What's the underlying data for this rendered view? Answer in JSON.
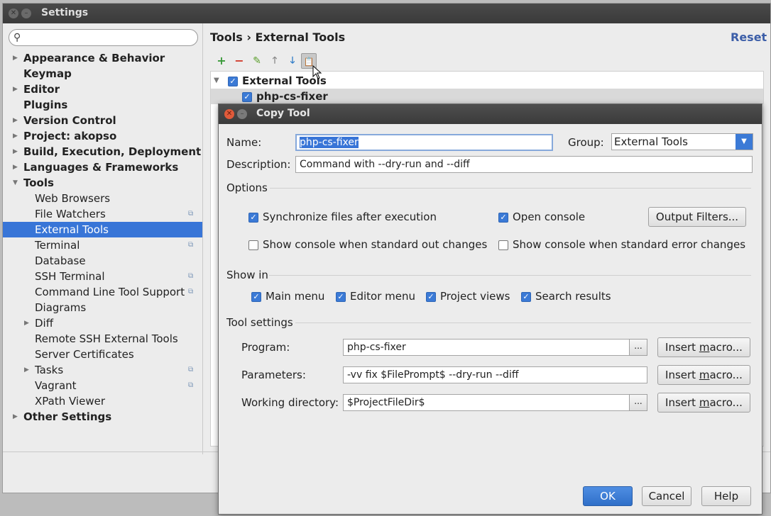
{
  "window": {
    "title": "Settings"
  },
  "search": {
    "placeholder": ""
  },
  "sidebar": {
    "items": [
      {
        "label": "Appearance & Behavior",
        "level": 0,
        "arrow": "▶"
      },
      {
        "label": "Keymap",
        "level": 0,
        "arrow": ""
      },
      {
        "label": "Editor",
        "level": 0,
        "arrow": "▶"
      },
      {
        "label": "Plugins",
        "level": 0,
        "arrow": ""
      },
      {
        "label": "Version Control",
        "level": 0,
        "arrow": "▶"
      },
      {
        "label": "Project: akopso",
        "level": 0,
        "arrow": "▶"
      },
      {
        "label": "Build, Execution, Deployment",
        "level": 0,
        "arrow": "▶"
      },
      {
        "label": "Languages & Frameworks",
        "level": 0,
        "arrow": "▶"
      },
      {
        "label": "Tools",
        "level": 0,
        "arrow": "▼"
      },
      {
        "label": "Web Browsers",
        "level": 1,
        "arrow": ""
      },
      {
        "label": "File Watchers",
        "level": 1,
        "arrow": "",
        "project": true
      },
      {
        "label": "External Tools",
        "level": 1,
        "arrow": "",
        "selected": true
      },
      {
        "label": "Terminal",
        "level": 1,
        "arrow": "",
        "project": true
      },
      {
        "label": "Database",
        "level": 1,
        "arrow": ""
      },
      {
        "label": "SSH Terminal",
        "level": 1,
        "arrow": "",
        "project": true
      },
      {
        "label": "Command Line Tool Support",
        "level": 1,
        "arrow": "",
        "project": true
      },
      {
        "label": "Diagrams",
        "level": 1,
        "arrow": ""
      },
      {
        "label": "Diff",
        "level": 1,
        "arrow": "▶"
      },
      {
        "label": "Remote SSH External Tools",
        "level": 1,
        "arrow": ""
      },
      {
        "label": "Server Certificates",
        "level": 1,
        "arrow": ""
      },
      {
        "label": "Tasks",
        "level": 1,
        "arrow": "▶",
        "project": true
      },
      {
        "label": "Vagrant",
        "level": 1,
        "arrow": "",
        "project": true
      },
      {
        "label": "XPath Viewer",
        "level": 1,
        "arrow": ""
      },
      {
        "label": "Other Settings",
        "level": 0,
        "arrow": "▶"
      }
    ]
  },
  "header": {
    "breadcrumb": "Tools › External Tools",
    "reset": "Reset"
  },
  "toolbar": {
    "add": "+",
    "remove": "−",
    "edit": "✎",
    "up": "🡑",
    "down": "🡓",
    "copy": "📋"
  },
  "list": {
    "group": "External Tools",
    "tool": "php-cs-fixer"
  },
  "dialog": {
    "title": "Copy Tool",
    "name_label": "Name:",
    "name_value": "php-cs-fixer",
    "group_label": "Group:",
    "group_value": "External Tools",
    "description_label": "Description:",
    "description_value": "Command with --dry-run and --diff",
    "options_title": "Options",
    "sync_files": "Synchronize files after execution",
    "open_console": "Open console",
    "output_filters": "Output Filters...",
    "show_console_out": "Show console when standard out changes",
    "show_console_err": "Show console when standard error changes",
    "show_in_title": "Show in",
    "main_menu": "Main menu",
    "editor_menu": "Editor menu",
    "project_views": "Project views",
    "search_results": "Search results",
    "tool_settings_title": "Tool settings",
    "program_label": "Program:",
    "program_value": "php-cs-fixer",
    "parameters_label": "Parameters:",
    "parameters_value": "-vv fix $FilePrompt$ --dry-run --diff",
    "workdir_label": "Working directory:",
    "workdir_value": "$ProjectFileDir$",
    "insert_macro_pre": "Insert ",
    "insert_macro_u": "m",
    "insert_macro_post": "acro...",
    "browse": "...",
    "ok": "OK",
    "cancel": "Cancel",
    "help": "Help"
  },
  "colors": {
    "accent": "#3875d7",
    "checkbox": "#3b7ad6",
    "link": "#3c5ea8"
  }
}
